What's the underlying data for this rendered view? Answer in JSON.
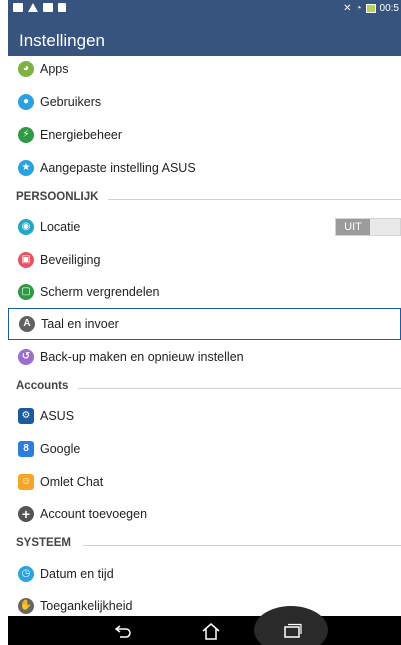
{
  "status_bar": {
    "time": "00:5",
    "left_icons": [
      "notification-icon",
      "warning-icon",
      "sync-icon",
      "document-icon"
    ],
    "right_icons": [
      "mute-icon",
      "wifi-icon",
      "battery-icon"
    ]
  },
  "action_bar": {
    "title": "Instellingen"
  },
  "items": {
    "apps": {
      "label": "Apps",
      "icon": "apps-icon",
      "color": "#7cb342"
    },
    "users": {
      "label": "Gebruikers",
      "icon": "users-icon",
      "color": "#29a3e0"
    },
    "power": {
      "label": "Energiebeheer",
      "icon": "power-icon",
      "color": "#2e9a43"
    },
    "asus_custom": {
      "label": "Aangepaste instelling ASUS",
      "icon": "asus-custom-icon",
      "color": "#29a3e0"
    },
    "location": {
      "label": "Locatie",
      "icon": "location-icon",
      "color": "#22a7c9"
    },
    "security": {
      "label": "Beveiliging",
      "icon": "lock-icon",
      "color": "#e65363"
    },
    "screen_lock": {
      "label": "Scherm vergrendelen",
      "icon": "screen-lock-icon",
      "color": "#2e9a43"
    },
    "language": {
      "label": "Taal en invoer",
      "icon": "language-icon",
      "color": "#616161"
    },
    "backup": {
      "label": "Back-up maken en opnieuw instellen",
      "icon": "backup-icon",
      "color": "#9c6cd0"
    },
    "asus_account": {
      "label": "ASUS",
      "icon": "asus-icon",
      "color": "#1e5aa0"
    },
    "google": {
      "label": "Google",
      "icon": "google-icon",
      "color": "#2d7de0"
    },
    "omlet": {
      "label": "Omlet Chat",
      "icon": "omlet-icon",
      "color": "#f6a623"
    },
    "add_account": {
      "label": "Account toevoegen",
      "icon": "add-icon",
      "color": "#555555"
    },
    "datetime": {
      "label": "Datum en tijd",
      "icon": "clock-icon",
      "color": "#29a3e0"
    },
    "accessibility": {
      "label": "Toegankelijkheid",
      "icon": "hand-icon",
      "color": "#666666"
    }
  },
  "headers": {
    "personal": "PERSOONLIJK",
    "accounts": "Accounts",
    "system": "SYSTEEM"
  },
  "location_toggle": {
    "state": "UIT"
  },
  "nav": {
    "back_icon": "back-icon",
    "home_icon": "home-icon",
    "recents_icon": "recents-icon"
  }
}
